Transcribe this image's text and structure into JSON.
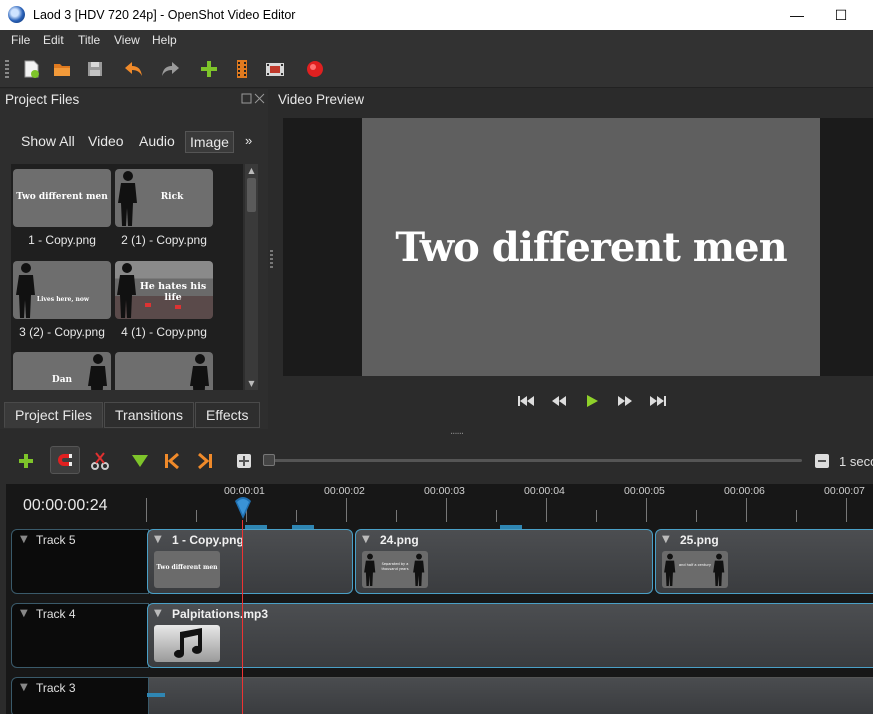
{
  "window": {
    "title": "Laod 3 [HDV 720 24p] - OpenShot Video Editor",
    "minimize": "—",
    "maximize": "☐"
  },
  "menu": [
    "File",
    "Edit",
    "Title",
    "View",
    "Help"
  ],
  "toolbar": {
    "icons": [
      "new-project-icon",
      "open-project-icon",
      "save-project-icon",
      "undo-icon",
      "redo-icon",
      "import-files-icon",
      "profile-icon",
      "export-film-icon",
      "record-icon"
    ]
  },
  "project_files": {
    "title": "Project Files",
    "filter_tabs": [
      "Show All",
      "Video",
      "Audio",
      "Image"
    ],
    "active_filter": "Image",
    "more": "»",
    "files": [
      {
        "label": "1 - Copy.png",
        "overlay": "Two different men"
      },
      {
        "label": "2 (1) - Copy.png",
        "overlay": "Rick"
      },
      {
        "label": "3 (2) - Copy.png",
        "overlay": "Lives here, now"
      },
      {
        "label": "4 (1) - Copy.png",
        "overlay": "He hates his life"
      },
      {
        "label": "",
        "overlay": "Dan"
      },
      {
        "label": "",
        "overlay": ""
      }
    ],
    "bottom_tabs": [
      "Project Files",
      "Transitions",
      "Effects"
    ],
    "active_bottom_tab": "Project Files"
  },
  "preview": {
    "title": "Video Preview",
    "frame_text": "Two different men",
    "splitter": "......"
  },
  "timeline": {
    "zoom_label": "1 seco",
    "current_time": "00:00:00:24",
    "ruler": [
      "00:00:01",
      "00:00:02",
      "00:00:03",
      "00:00:04",
      "00:00:05",
      "00:00:06",
      "00:00:07"
    ],
    "tracks": [
      {
        "name": "Track 5",
        "clips": [
          {
            "title": "1 - Copy.png",
            "thumb_text": "Two different men"
          },
          {
            "title": "24.png",
            "thumb_text": "Separated by a thousand years"
          },
          {
            "title": "25.png",
            "thumb_text": "and half a century"
          }
        ]
      },
      {
        "name": "Track 4",
        "clips": [
          {
            "title": "Palpitations.mp3",
            "thumb_text": ""
          }
        ]
      },
      {
        "name": "Track 3",
        "clips": []
      }
    ]
  },
  "colors": {
    "accent": "#4aa0c7",
    "playhead": "#e33333",
    "record": "#e02020",
    "green": "#7ec42a"
  }
}
